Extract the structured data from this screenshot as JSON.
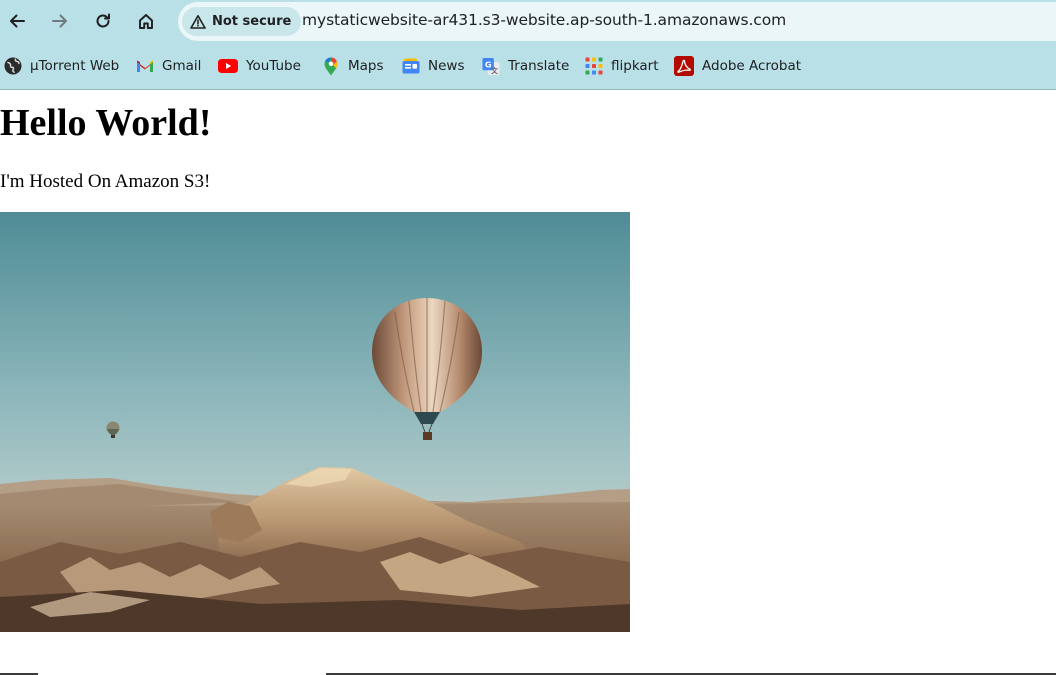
{
  "browser": {
    "nav": {
      "back_icon": "arrow-left-icon",
      "forward_icon": "arrow-right-icon",
      "reload_icon": "reload-icon",
      "home_icon": "home-icon"
    },
    "security_label": "Not secure",
    "url": "mystaticwebsite-ar431.s3-website.ap-south-1.amazonaws.com"
  },
  "bookmarks": [
    {
      "label": "µTorrent Web",
      "icon": "globe-icon"
    },
    {
      "label": "Gmail",
      "icon": "gmail-icon"
    },
    {
      "label": "YouTube",
      "icon": "youtube-icon"
    },
    {
      "label": "Maps",
      "icon": "maps-pin-icon"
    },
    {
      "label": "News",
      "icon": "news-icon"
    },
    {
      "label": "Translate",
      "icon": "translate-icon"
    },
    {
      "label": "flipkart",
      "icon": "grid-apps-icon"
    },
    {
      "label": "Adobe Acrobat",
      "icon": "acrobat-icon"
    }
  ],
  "page": {
    "heading": "Hello World!",
    "paragraph": "I'm Hosted On Amazon S3!",
    "image_subject": "hot-air-balloons-over-valley"
  },
  "colors": {
    "toolbar_bg": "#b8e0e6",
    "omnibox_bg": "#eaf6f7",
    "chip_bg": "#c9e6ea"
  }
}
